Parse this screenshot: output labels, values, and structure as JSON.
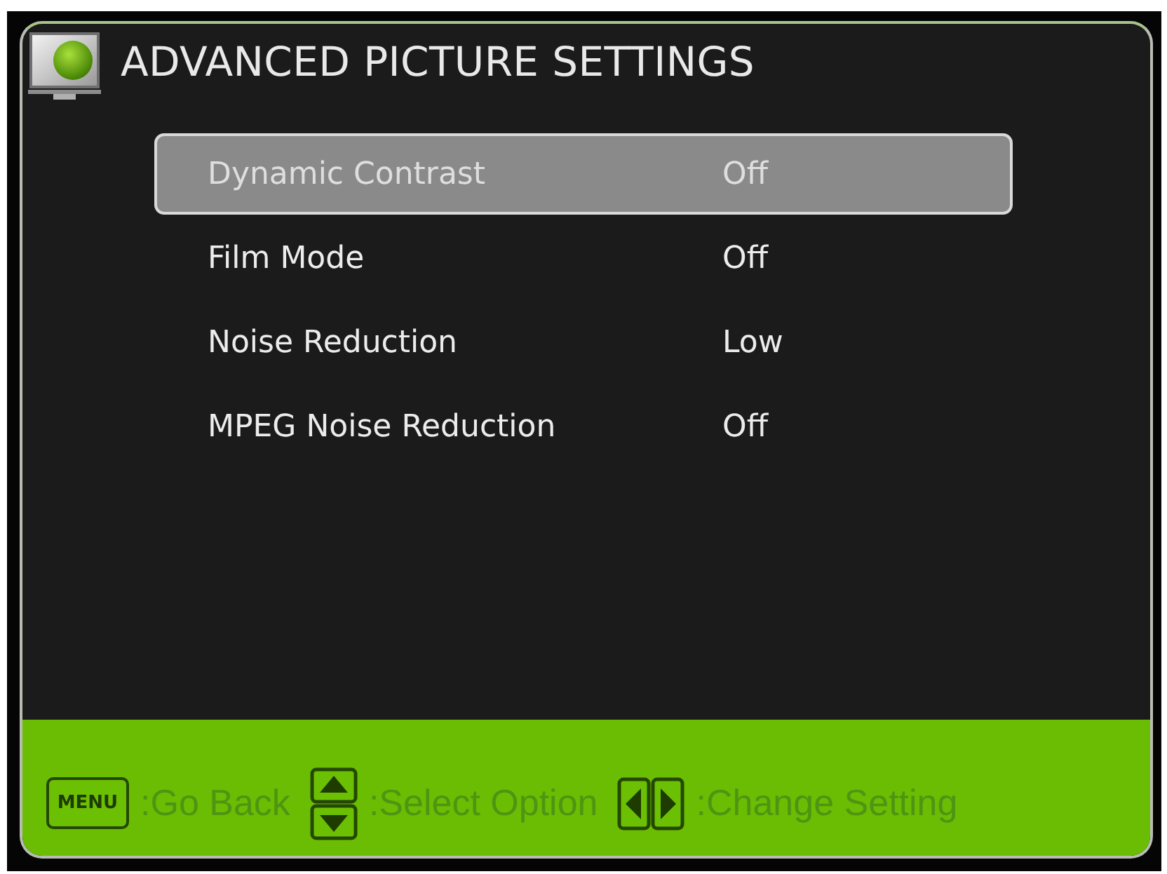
{
  "window": {
    "title": "ADVANCED PICTURE SETTINGS"
  },
  "menu": {
    "items": [
      {
        "label": "Dynamic Contrast",
        "value": "Off",
        "selected": true
      },
      {
        "label": "Film Mode",
        "value": "Off",
        "selected": false
      },
      {
        "label": "Noise Reduction",
        "value": "Low",
        "selected": false
      },
      {
        "label": "MPEG Noise Reduction",
        "value": "Off",
        "selected": false
      }
    ]
  },
  "footer": {
    "hints": [
      {
        "kind": "menu",
        "key": "MENU",
        "label": ":Go Back"
      },
      {
        "kind": "updown",
        "label": ":Select Option"
      },
      {
        "kind": "leftright",
        "label": ":Change Setting"
      }
    ]
  }
}
